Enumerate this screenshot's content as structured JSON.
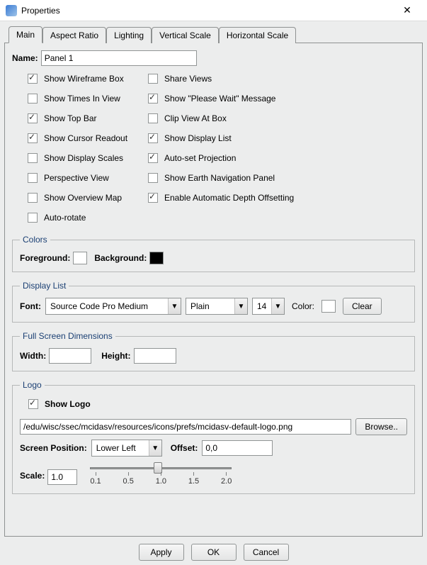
{
  "window": {
    "title": "Properties"
  },
  "tabs": [
    "Main",
    "Aspect Ratio",
    "Lighting",
    "Vertical Scale",
    "Horizontal Scale"
  ],
  "name": {
    "label": "Name:",
    "value": "Panel 1"
  },
  "checkboxes": {
    "left": [
      {
        "label": "Show Wireframe Box",
        "checked": true
      },
      {
        "label": "Show Times In View",
        "checked": false
      },
      {
        "label": "Show Top Bar",
        "checked": true
      },
      {
        "label": "Show Cursor Readout",
        "checked": true
      },
      {
        "label": "Show Display Scales",
        "checked": false
      },
      {
        "label": "Perspective View",
        "checked": false
      },
      {
        "label": "Show Overview Map",
        "checked": false
      },
      {
        "label": "Auto-rotate",
        "checked": false
      }
    ],
    "right": [
      {
        "label": "Share Views",
        "checked": false
      },
      {
        "label": "Show \"Please Wait\" Message",
        "checked": true
      },
      {
        "label": "Clip View At Box",
        "checked": false
      },
      {
        "label": "Show Display List",
        "checked": true
      },
      {
        "label": "Auto-set Projection",
        "checked": true
      },
      {
        "label": "Show Earth Navigation Panel",
        "checked": false
      },
      {
        "label": "Enable Automatic Depth Offsetting",
        "checked": true
      }
    ]
  },
  "colors": {
    "legend": "Colors",
    "foreground_label": "Foreground:",
    "foreground_value": "#ffffff",
    "background_label": "Background:",
    "background_value": "#000000"
  },
  "display_list": {
    "legend": "Display List",
    "font_label": "Font:",
    "font_value": "Source Code Pro Medium",
    "style_value": "Plain",
    "size_value": "14",
    "color_label": "Color:",
    "color_value": "#ffffff",
    "clear_label": "Clear"
  },
  "full_screen": {
    "legend": "Full Screen Dimensions",
    "width_label": "Width:",
    "width_value": "",
    "height_label": "Height:",
    "height_value": ""
  },
  "logo": {
    "legend": "Logo",
    "show_label": "Show Logo",
    "show_checked": true,
    "path_value": "/edu/wisc/ssec/mcidasv/resources/icons/prefs/mcidasv-default-logo.png",
    "browse_label": "Browse..",
    "position_label": "Screen Position:",
    "position_value": "Lower Left",
    "offset_label": "Offset:",
    "offset_value": "0,0",
    "scale_label": "Scale:",
    "scale_value": "1.0",
    "ticks": [
      "0.1",
      "0.5",
      "1.0",
      "1.5",
      "2.0"
    ]
  },
  "buttons": {
    "apply": "Apply",
    "ok": "OK",
    "cancel": "Cancel"
  }
}
